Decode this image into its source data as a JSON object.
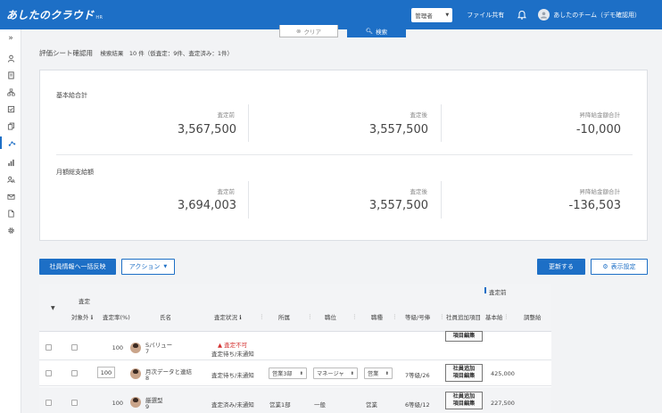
{
  "header": {
    "logo": "あしたのクラウド",
    "logo_suffix": "HR",
    "role": "管理者",
    "file_share": "ファイル共有",
    "team": "あしたのチーム（デモ確認用）"
  },
  "buttons": {
    "clear": "クリア",
    "search": "検索",
    "bulk_transfer": "社員情報へ一括反映",
    "action": "アクション",
    "update": "更新する",
    "display_settings": "表示設定"
  },
  "result": {
    "title": "評価シート確認用",
    "summary": "検索結果　10 件（仮査定：9件、査定済み：1件）"
  },
  "summary": {
    "base": {
      "title": "基本給合計",
      "before_label": "査定前",
      "before": "3,567,500",
      "after_label": "査定後",
      "after": "3,557,500",
      "diff_label": "昇降給金額合計",
      "diff": "-10,000"
    },
    "monthly": {
      "title": "月額総支給額",
      "before_label": "査定前",
      "before": "3,694,003",
      "after_label": "査定後",
      "after": "3,557,500",
      "diff_label": "昇降給金額合計",
      "diff": "-136,503"
    }
  },
  "table": {
    "group_label": "査定前",
    "headers": {
      "target_1": "査定",
      "target_2": "対象外",
      "rate": "査定率(%)",
      "name": "氏名",
      "status": "査定状況",
      "dept": "所属",
      "position": "職位",
      "job": "職種",
      "grade": "等級/号俸",
      "extra": "社員追加項目",
      "base_pay": "基本給",
      "adjust": "調整給"
    },
    "rows": [
      {
        "rate": "100",
        "name": "Sバリュー",
        "num": "7",
        "warn": "査定不可",
        "status": "査定待ち/未通知",
        "extra_1": "項目編集"
      },
      {
        "rate": "100",
        "name": "月次データと連結",
        "num": "8",
        "status": "査定待ち/未通知",
        "dept": "営業3部",
        "position": "マネージャ",
        "job": "営業",
        "grade": "7等級/26",
        "extra_1": "社員追加",
        "extra_2": "項目編集",
        "base_pay": "425,000"
      },
      {
        "rate": "100",
        "name": "厳選型",
        "num": "9",
        "status": "査定済み/未通知",
        "dept": "営業1部",
        "position": "一般",
        "job": "営業",
        "grade": "6等級/12",
        "extra_1": "社員追加",
        "extra_2": "項目編集",
        "base_pay": "227,500"
      }
    ]
  }
}
